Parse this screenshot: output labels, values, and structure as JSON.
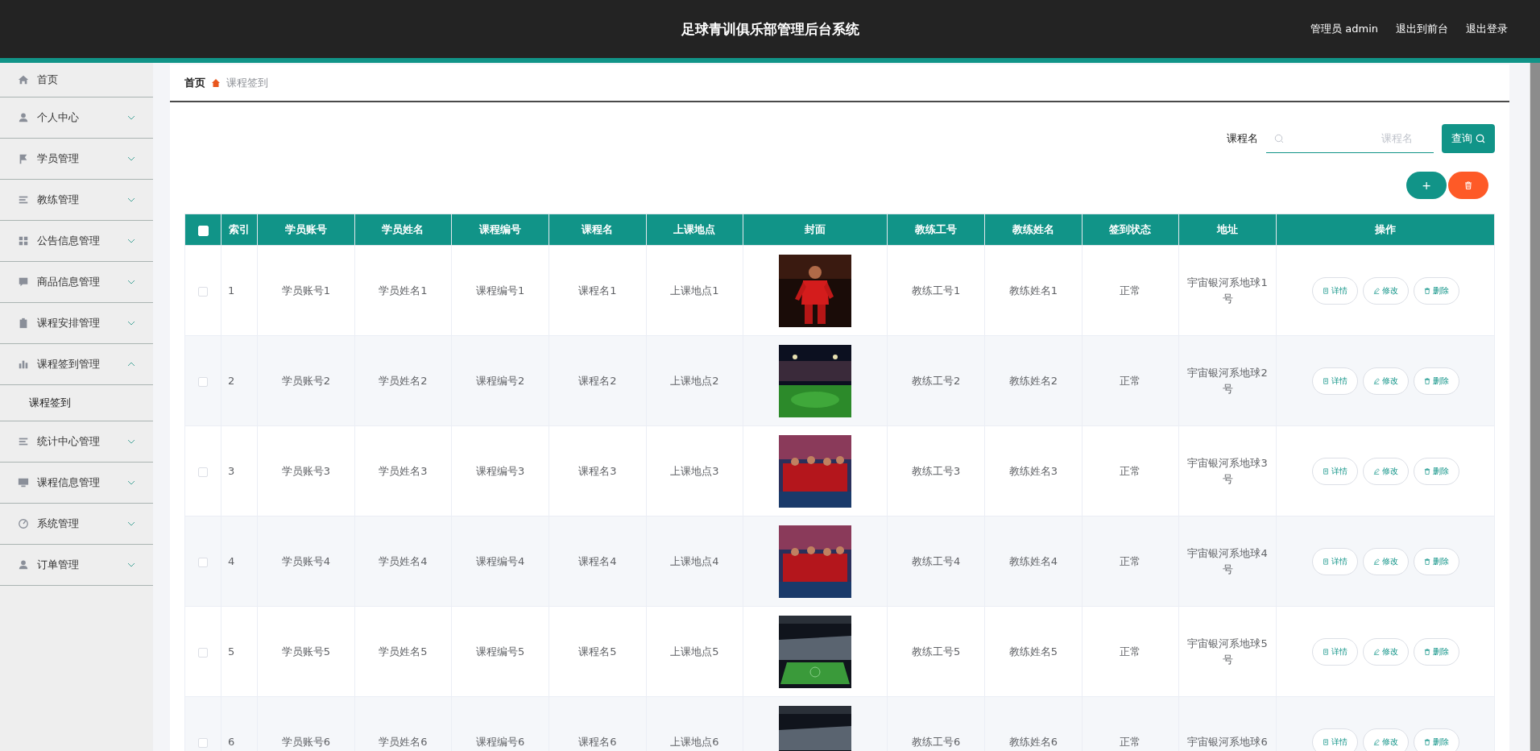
{
  "header": {
    "title": "足球青训俱乐部管理后台系统",
    "user": "管理员 admin",
    "links": [
      "退出到前台",
      "退出登录"
    ]
  },
  "sidebar": {
    "items": [
      {
        "label": "首页",
        "kind": "link"
      },
      {
        "label": "个人中心",
        "kind": "menu",
        "expanded": false
      },
      {
        "label": "学员管理",
        "kind": "menu",
        "expanded": false
      },
      {
        "label": "教练管理",
        "kind": "menu",
        "expanded": false
      },
      {
        "label": "公告信息管理",
        "kind": "menu",
        "expanded": false
      },
      {
        "label": "商品信息管理",
        "kind": "menu",
        "expanded": false
      },
      {
        "label": "课程安排管理",
        "kind": "menu",
        "expanded": false
      },
      {
        "label": "课程签到管理",
        "kind": "menu",
        "expanded": true,
        "children": [
          {
            "label": "课程签到"
          }
        ]
      },
      {
        "label": "统计中心管理",
        "kind": "menu",
        "expanded": false
      },
      {
        "label": "课程信息管理",
        "kind": "menu",
        "expanded": false
      },
      {
        "label": "系统管理",
        "kind": "menu",
        "expanded": false
      },
      {
        "label": "订单管理",
        "kind": "menu",
        "expanded": false
      }
    ]
  },
  "breadcrumb": [
    "首页",
    "课程签到"
  ],
  "search": {
    "label": "课程名",
    "placeholder": "课程名",
    "button": "查询"
  },
  "actions": {
    "add": "+"
  },
  "table": {
    "select_all_checked": false,
    "columns": [
      "索引",
      "学员账号",
      "学员姓名",
      "课程编号",
      "课程名",
      "上课地点",
      "封面",
      "教练工号",
      "教练姓名",
      "签到状态",
      "地址",
      "操作"
    ],
    "rows": [
      {
        "checked": false,
        "cells": [
          "1",
          "学员账号1",
          "学员姓名1",
          "课程编号1",
          "课程名1",
          "上课地点1",
          {
            "kind": "picture"
          },
          "教练工号1",
          "教练姓名1",
          "正常",
          "宇宙银河系地球1号",
          {
            "kind": "actions",
            "labels": [
              "详情",
              "修改",
              "删除"
            ]
          }
        ]
      },
      {
        "checked": false,
        "cells": [
          "2",
          "学员账号2",
          "学员姓名2",
          "课程编号2",
          "课程名2",
          "上课地点2",
          {
            "kind": "picture"
          },
          "教练工号2",
          "教练姓名2",
          "正常",
          "宇宙银河系地球2号",
          {
            "kind": "actions",
            "labels": [
              "详情",
              "修改",
              "删除"
            ]
          }
        ]
      },
      {
        "checked": false,
        "cells": [
          "3",
          "学员账号3",
          "学员姓名3",
          "课程编号3",
          "课程名3",
          "上课地点3",
          {
            "kind": "picture"
          },
          "教练工号3",
          "教练姓名3",
          "正常",
          "宇宙银河系地球3号",
          {
            "kind": "actions",
            "labels": [
              "详情",
              "修改",
              "删除"
            ]
          }
        ]
      },
      {
        "checked": false,
        "cells": [
          "4",
          "学员账号4",
          "学员姓名4",
          "课程编号4",
          "课程名4",
          "上课地点4",
          {
            "kind": "picture"
          },
          "教练工号4",
          "教练姓名4",
          "正常",
          "宇宙银河系地球4号",
          {
            "kind": "actions",
            "labels": [
              "详情",
              "修改",
              "删除"
            ]
          }
        ]
      },
      {
        "checked": false,
        "cells": [
          "5",
          "学员账号5",
          "学员姓名5",
          "课程编号5",
          "课程名5",
          "上课地点5",
          {
            "kind": "picture"
          },
          "教练工号5",
          "教练姓名5",
          "正常",
          "宇宙银河系地球5号",
          {
            "kind": "actions",
            "labels": [
              "详情",
              "修改",
              "删除"
            ]
          }
        ]
      },
      {
        "checked": false,
        "cells": [
          "6",
          "学员账号6",
          "学员姓名6",
          "课程编号6",
          "课程名6",
          "上课地点6",
          {
            "kind": "picture"
          },
          "教练工号6",
          "教练姓名6",
          "正常",
          "宇宙银河系地球6",
          {
            "kind": "actions",
            "labels": [
              "详情",
              "修改",
              "删除"
            ]
          }
        ]
      }
    ]
  }
}
